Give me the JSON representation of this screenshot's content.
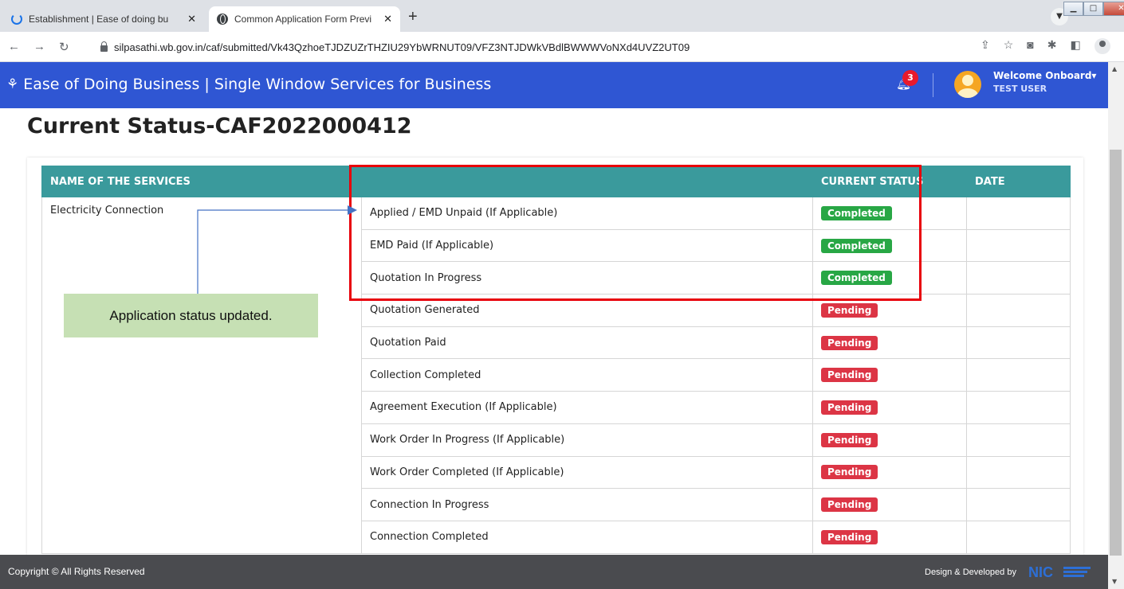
{
  "browser": {
    "tabs": [
      {
        "title": "Establishment | Ease of doing bu",
        "close": "✕"
      },
      {
        "title": "Common Application Form Previ",
        "close": "✕"
      }
    ],
    "new_tab": "+",
    "url": "silpasathi.wb.gov.in/caf/submitted/Vk43QzhoeTJDZUZrTHZIU29YbWRNUT09/VFZ3NTJDWkVBdlBWWWVoNXd4UVZ2UT09"
  },
  "header": {
    "brand_icon": "⚘",
    "title": "Ease of Doing Business | Single Window Services for Business",
    "notification_count": "3",
    "welcome": "Welcome Onboard",
    "user": "TEST USER"
  },
  "page": {
    "title_prefix": "Current Status-",
    "title_id": "CAF2022000412"
  },
  "table": {
    "headers": [
      "NAME OF THE SERVICES",
      "",
      "CURRENT STATUS",
      "DATE"
    ],
    "service_name": "Electricity Connection",
    "rows": [
      {
        "step": "Applied / EMD Unpaid (If Applicable)",
        "status": "Completed"
      },
      {
        "step": "EMD Paid (If Applicable)",
        "status": "Completed"
      },
      {
        "step": "Quotation In Progress",
        "status": "Completed"
      },
      {
        "step": "Quotation Generated",
        "status": "Pending"
      },
      {
        "step": "Quotation Paid",
        "status": "Pending"
      },
      {
        "step": "Collection Completed",
        "status": "Pending"
      },
      {
        "step": "Agreement Execution (If Applicable)",
        "status": "Pending"
      },
      {
        "step": "Work Order In Progress (If Applicable)",
        "status": "Pending"
      },
      {
        "step": "Work Order Completed (If Applicable)",
        "status": "Pending"
      },
      {
        "step": "Connection In Progress",
        "status": "Pending"
      },
      {
        "step": "Connection Completed",
        "status": "Pending"
      }
    ]
  },
  "annotation": {
    "callout": "Application status updated."
  },
  "footer": {
    "copyright": "Copyright © All Rights Reserved",
    "developed": "Design & Developed by",
    "logo_text": "NIC"
  },
  "colors": {
    "header_bg": "#2f56d3",
    "table_header": "#3a9a9c",
    "completed": "#28a745",
    "pending": "#dc3545",
    "highlight": "#e8000a",
    "callout_bg": "#c6e0b4",
    "footer_bg": "#4a4b4f"
  }
}
